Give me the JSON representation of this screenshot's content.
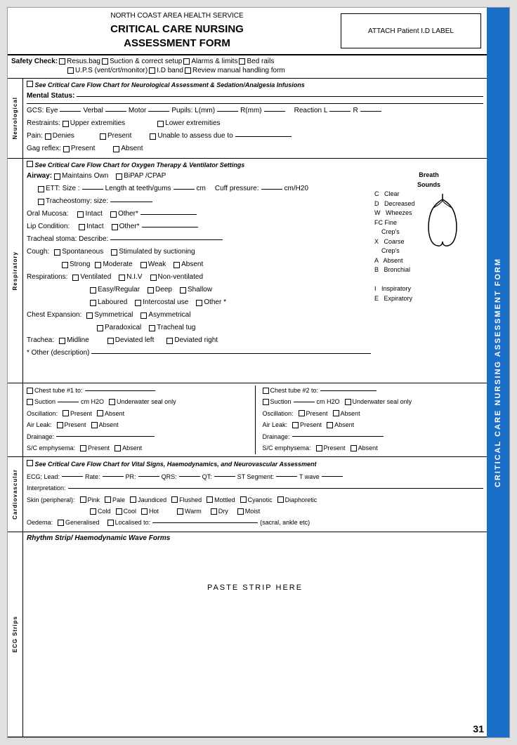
{
  "header": {
    "org_name": "NORTH COAST AREA HEALTH SERVICE",
    "form_title_line1": "CRITICAL CARE NURSING",
    "form_title_line2": "ASSESSMENT FORM",
    "patient_label": "ATTACH Patient I.D LABEL"
  },
  "side_tab": {
    "text": "CRITICAL CARE NURSING ASSESSMENT FORM"
  },
  "page_number": "31",
  "safety_check": {
    "label": "Safety Check:",
    "items_row1": [
      "Resus.bag",
      "Suction & correct setup",
      "Alarms & limits",
      "Bed rails"
    ],
    "items_row2": [
      "U.P.S (vent/crt/monitor)",
      "I.D band",
      "Review manual handling form"
    ]
  },
  "neurological": {
    "section_label": "Neurological",
    "note": "See Critical Care Flow Chart for Neurological Assessment & Sedation/Analgesia Infusions",
    "mental_status_label": "Mental Status:",
    "gcs_label": "GCS: Eye",
    "gcs_verbal": "Verbal",
    "gcs_motor": "Motor",
    "pupils_label": "Pupils: L(mm)",
    "pupils_r": "R(mm)",
    "reaction_label": "Reaction  L",
    "reaction_r": "R",
    "restraints_label": "Restraints:",
    "upper_extremities": "Upper extremities",
    "lower_extremities": "Lower extremities",
    "pain_label": "Pain:",
    "pain_denies": "Denies",
    "pain_present": "Present",
    "pain_unable": "Unable to assess due to",
    "gag_reflex_label": "Gag reflex:",
    "gag_present": "Present",
    "gag_absent": "Absent"
  },
  "respiratory": {
    "section_label": "Respiratory",
    "note": "See Critical Care Flow Chart for Oxygen Therapy & Ventilator Settings",
    "airway_label": "Airway:",
    "maintains_own": "Maintains Own",
    "bipap": "BiPAP /CPAP",
    "ett_label": "ETT:",
    "ett_size": "Size :",
    "ett_length": "Length at teeth/gums",
    "ett_cm": "cm",
    "cuff_pressure": "Cuff pressure:",
    "cuff_unit": "cm/H20",
    "tracheostomy": "Tracheostomy: size:",
    "breath_sounds_title": "Breath",
    "breath_sounds_title2": "Sounds",
    "breath_sounds": [
      {
        "code": "C",
        "label": "Clear"
      },
      {
        "code": "D",
        "label": "Decreased"
      },
      {
        "code": "W",
        "label": "Wheezes"
      },
      {
        "code": "FC",
        "label": "Fine"
      },
      {
        "code": "",
        "label": "Crep's"
      },
      {
        "code": "X",
        "label": "Coarse"
      },
      {
        "code": "",
        "label": "Crep's"
      },
      {
        "code": "A",
        "label": "Absent"
      },
      {
        "code": "B",
        "label": "Bronchial"
      },
      {
        "code": "I",
        "label": "Inspiratory"
      },
      {
        "code": "E",
        "label": "Expiratory"
      }
    ],
    "oral_mucosa_label": "Oral Mucosa:",
    "intact": "Intact",
    "other": "Other*",
    "lip_condition_label": "Lip Condition:",
    "tracheal_stoma_label": "Tracheal stoma: Describe:",
    "cough_label": "Cough:",
    "spontaneous": "Spontaneous",
    "stimulated": "Stimulated by suctioning",
    "strong": "Strong",
    "moderate": "Moderate",
    "weak": "Weak",
    "absent": "Absent",
    "respirations_label": "Respirations:",
    "ventilated": "Ventilated",
    "niv": "N.I.V",
    "non_ventilated": "Non-ventilated",
    "easy_regular": "Easy/Regular",
    "deep": "Deep",
    "shallow": "Shallow",
    "laboured": "Laboured",
    "intercostal_use": "Intercostal use",
    "other2": "Other *",
    "chest_expansion_label": "Chest Expansion:",
    "symmetrical": "Symmetrical",
    "asymmetrical": "Asymmetrical",
    "paradoxical": "Paradoxical",
    "tracheal_tug": "Tracheal tug",
    "trachea_label": "Trachea:",
    "midline": "Midline",
    "deviated_left": "Deviated left",
    "deviated_right": "Deviated right",
    "other_desc_label": "* Other (description)"
  },
  "chest_tubes": {
    "tube1_label": "Chest tube #1 to:",
    "tube2_label": "Chest tube #2 to:",
    "suction_label": "Suction",
    "suction_unit": "cm H2O",
    "underwater_seal": "Underwater seal only",
    "oscillation_label": "Oscillation:",
    "present": "Present",
    "absent": "Absent",
    "air_leak_label": "Air Leak:",
    "drainage_label": "Drainage:",
    "sc_emphysema_label": "S/C emphysema:",
    "suction_label2": "Suction"
  },
  "cardiovascular": {
    "section_label": "Cardiovascular",
    "note": "See Critical Care Flow Chart for Vital Signs, Haemodynamics, and Neurovascular Assessment",
    "ecg_lead_label": "ECG; Lead:",
    "rate_label": "Rate:",
    "pr_label": "PR:",
    "qrs_label": "QRS:",
    "qt_label": "QT:",
    "st_segment_label": "ST Segment:",
    "t_wave_label": "T wave",
    "interpretation_label": "Interpretation:",
    "skin_label": "Skin (peripheral):",
    "skin_options": [
      "Pink",
      "Pale",
      "Jaundiced",
      "Flushed",
      "Mottled",
      "Cyanotic",
      "Diaphoretic"
    ],
    "skin_options2": [
      "Cold",
      "Cool",
      "Hot",
      "Warm",
      "Dry",
      "Moist"
    ],
    "oedema_label": "Oedema:",
    "generalised": "Generalised",
    "localised": "Localised to:",
    "sacral_etc": "(sacral, ankle etc)"
  },
  "ecg_strips": {
    "section_label": "ECG Strips",
    "rhythm_title": "Rhythm Strip/ Haemodynamic Wave Forms",
    "paste_strip": "PASTE STRIP HERE"
  }
}
